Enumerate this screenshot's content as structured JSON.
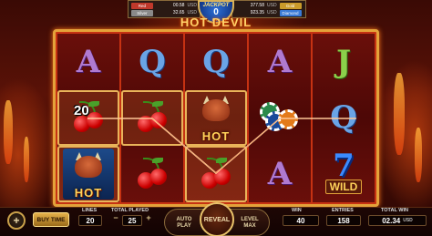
{
  "jackpot": {
    "title": "JACKPOT",
    "grand_value": "0",
    "grand_currency": "USD",
    "left_tiers": [
      {
        "name": "Red",
        "value": "00.58",
        "currency": "USD",
        "color": "#c0392b"
      },
      {
        "name": "Silver",
        "value": "32.65",
        "currency": "USD",
        "color": "#8a8a8a"
      }
    ],
    "right_tiers": [
      {
        "name": "Gold",
        "value": "377.58",
        "currency": "USD",
        "color": "#c99a2a"
      },
      {
        "name": "Diamond",
        "value": "923.35",
        "currency": "USD",
        "color": "#3a7ad6"
      }
    ]
  },
  "game": {
    "logo": "HOT DEVIL"
  },
  "reels": [
    [
      "A",
      "cherry",
      "devil-hot-blue"
    ],
    [
      "Q",
      "cherry",
      "cherry"
    ],
    [
      "Q",
      "devil-hot",
      "cherry"
    ],
    [
      "A",
      "chips",
      "A"
    ],
    [
      "J",
      "Q",
      "wild"
    ]
  ],
  "symbols": {
    "multiplier": "20",
    "hot_text": "HOT",
    "wild_text": "WILD",
    "seven": "7"
  },
  "colors": {
    "payline": "#ffe7c7",
    "frame": "#e4a23a",
    "win_highlight": "#e9b45a"
  },
  "controls": {
    "menu_icon": "plus-icon",
    "buy_time": "BUY TIME",
    "lines_label": "LINES",
    "lines_value": "20",
    "total_played_label": "TOTAL PLAYED",
    "total_played_value": "25",
    "decrease": "−",
    "increase": "+",
    "auto_play": "AUTO PLAY",
    "reveal": "REVEAL",
    "level_max": "LEVEL MAX",
    "win_label": "WIN",
    "win_value": "40",
    "entries_label": "ENTRIES",
    "entries_value": "158",
    "total_win_label": "TOTAL WIN",
    "total_win_value": "02.34",
    "total_win_currency": "USD"
  }
}
